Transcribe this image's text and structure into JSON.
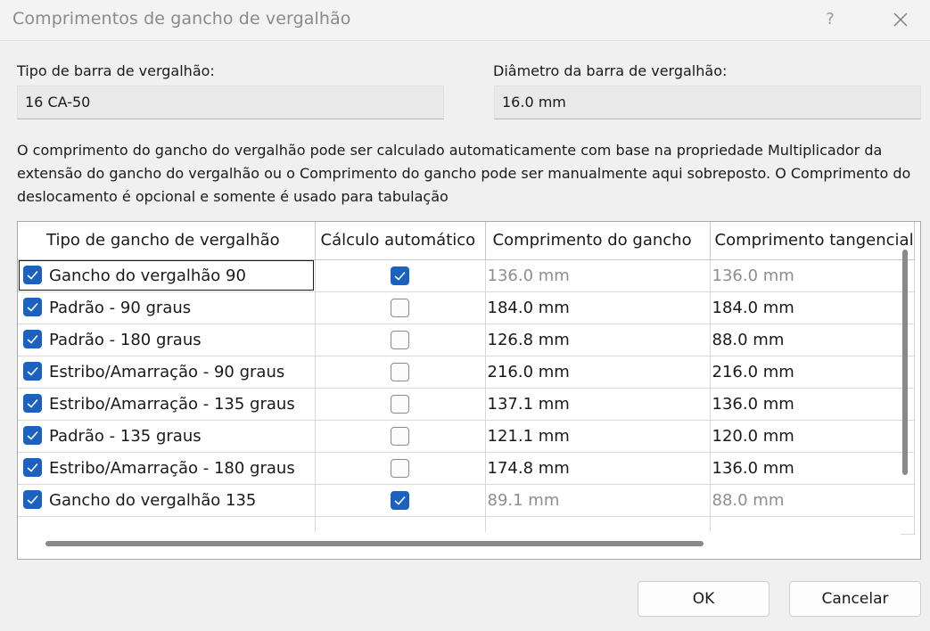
{
  "window": {
    "title": "Comprimentos de gancho de vergalhão",
    "help_label": "?"
  },
  "fields": {
    "bar_type_label": "Tipo de barra de vergalhão:",
    "bar_type_value": "16 CA-50",
    "diameter_label": "Diâmetro da barra de vergalhão:",
    "diameter_value": "16.0 mm"
  },
  "description": "O comprimento do gancho do vergalhão pode ser calculado automaticamente com base na propriedade Multiplicador da extensão do gancho do vergalhão ou o Comprimento do gancho pode ser manualmente aqui sobreposto.  O Comprimento do deslocamento é opcional e somente é usado para tabulação",
  "grid": {
    "columns": [
      "Tipo de gancho de vergalhão",
      "Cálculo automático",
      "Comprimento do gancho",
      "Comprimento tangencial"
    ],
    "rows": [
      {
        "enabled": true,
        "name": "Gancho do vergalhão 90",
        "auto": true,
        "hook_length": "136.0 mm",
        "tangent_length": "136.0 mm"
      },
      {
        "enabled": true,
        "name": "Padrão - 90 graus",
        "auto": false,
        "hook_length": "184.0 mm",
        "tangent_length": "184.0 mm"
      },
      {
        "enabled": true,
        "name": "Padrão - 180 graus",
        "auto": false,
        "hook_length": "126.8 mm",
        "tangent_length": "88.0 mm"
      },
      {
        "enabled": true,
        "name": "Estribo/Amarração - 90 graus",
        "auto": false,
        "hook_length": "216.0 mm",
        "tangent_length": "216.0 mm"
      },
      {
        "enabled": true,
        "name": "Estribo/Amarração - 135 graus",
        "auto": false,
        "hook_length": "137.1 mm",
        "tangent_length": "136.0 mm"
      },
      {
        "enabled": true,
        "name": "Padrão - 135 graus",
        "auto": false,
        "hook_length": "121.1 mm",
        "tangent_length": "120.0 mm"
      },
      {
        "enabled": true,
        "name": "Estribo/Amarração - 180 graus",
        "auto": false,
        "hook_length": "174.8 mm",
        "tangent_length": "136.0 mm"
      },
      {
        "enabled": true,
        "name": "Gancho do vergalhão 135",
        "auto": true,
        "hook_length": "89.1 mm",
        "tangent_length": "88.0 mm"
      }
    ]
  },
  "buttons": {
    "ok": "OK",
    "cancel": "Cancelar"
  },
  "colors": {
    "accent": "#1b62c0",
    "dim_text": "#8e8e8e"
  }
}
